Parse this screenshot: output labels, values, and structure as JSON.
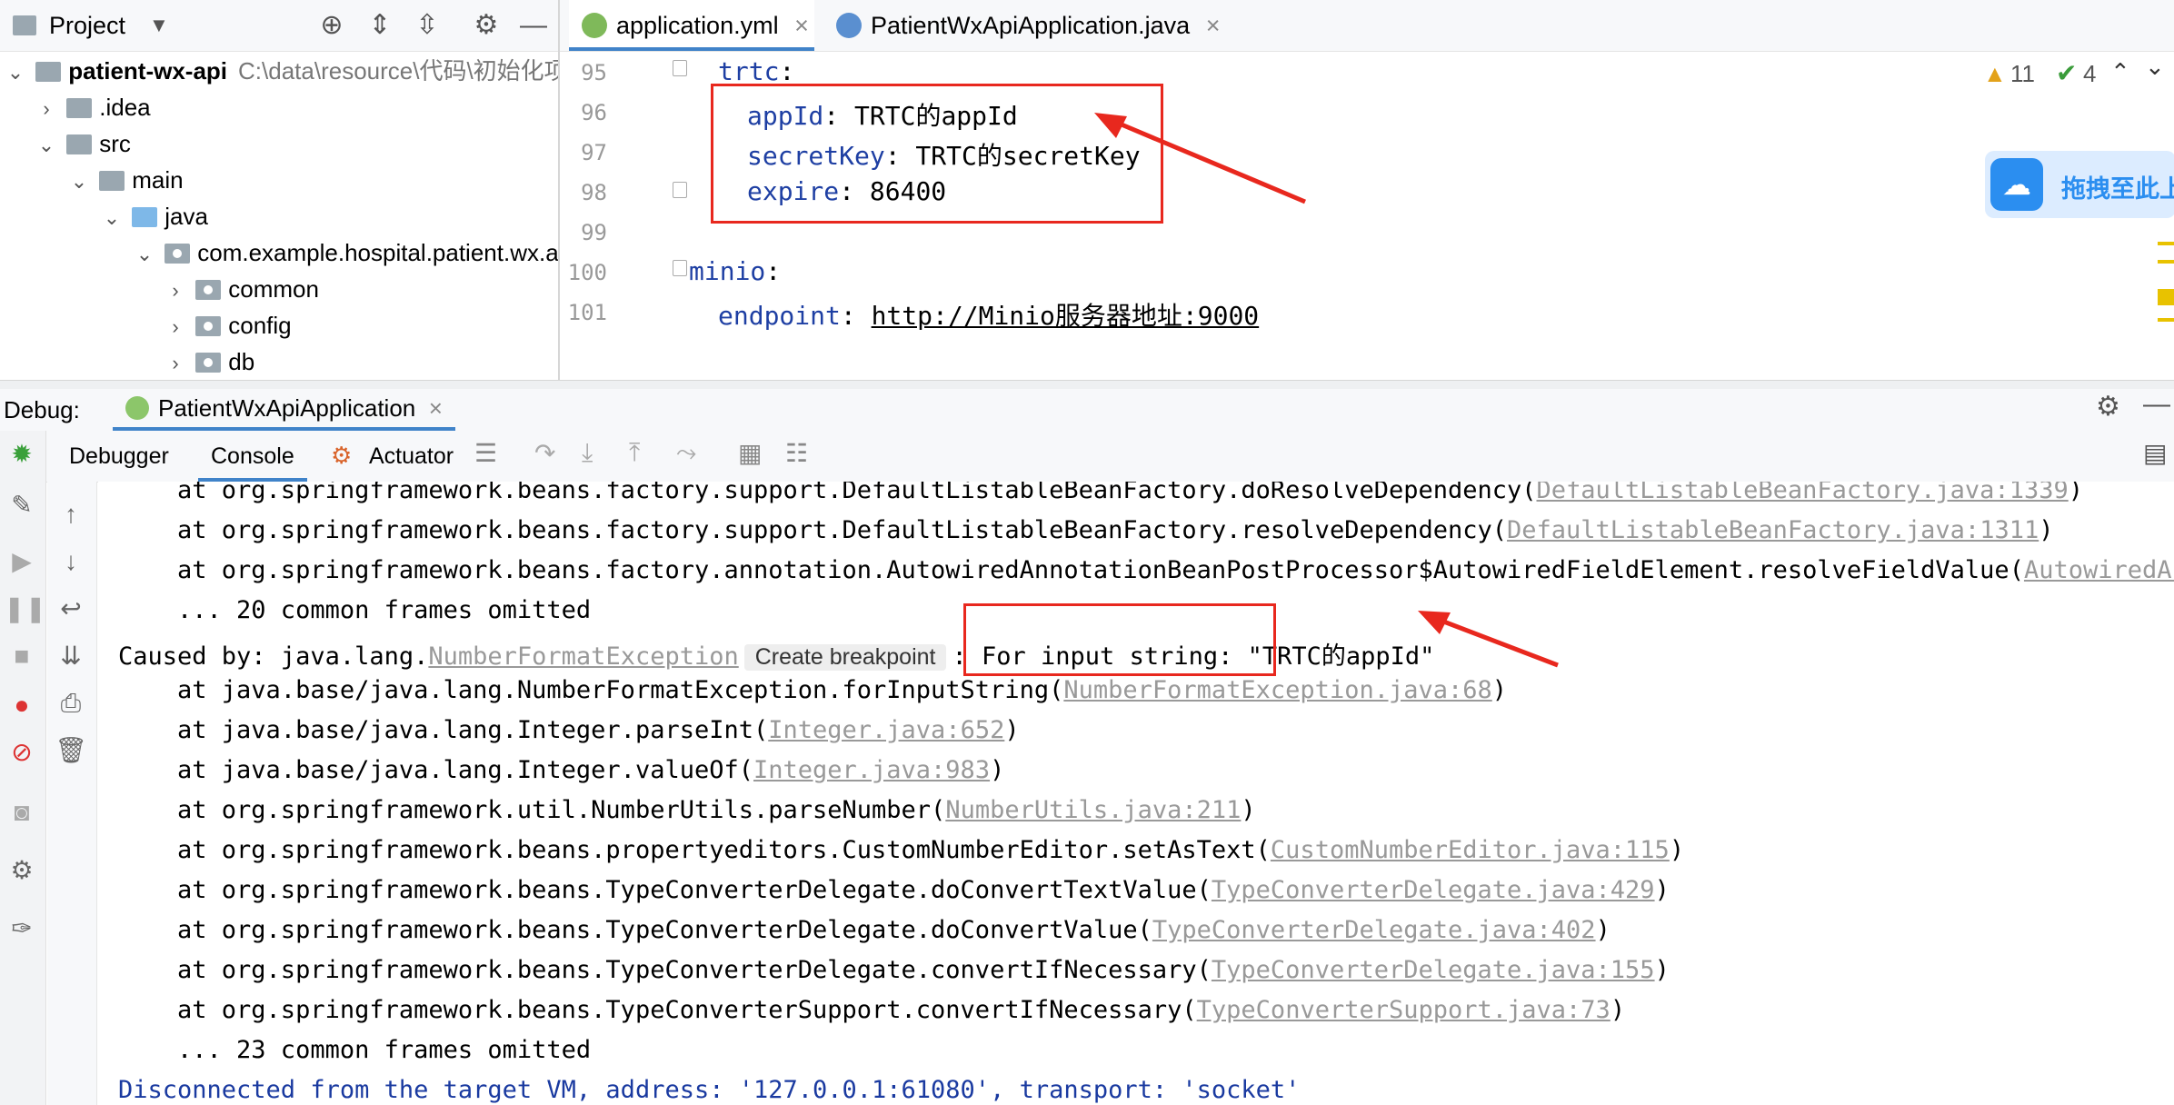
{
  "project": {
    "title": "Project",
    "root": "patient-wx-api",
    "root_path": "C:\\data\\resource\\代码\\初始化项",
    "items": [
      {
        "label": ".idea"
      },
      {
        "label": "src"
      },
      {
        "label": "main"
      },
      {
        "label": "java"
      },
      {
        "label": "com.example.hospital.patient.wx.a"
      },
      {
        "label": "common"
      },
      {
        "label": "config"
      },
      {
        "label": "db"
      }
    ]
  },
  "editor": {
    "tabs": [
      {
        "label": "application.yml"
      },
      {
        "label": "PatientWxApiApplication.java"
      }
    ],
    "lines": [
      {
        "num": "95",
        "key": "trtc",
        "rest": ":"
      },
      {
        "num": "96",
        "key": "appId",
        "rest": ": TRTC的appId"
      },
      {
        "num": "97",
        "key": "secretKey",
        "rest": ": TRTC的secretKey"
      },
      {
        "num": "98",
        "key": "expire",
        "rest": ": 86400"
      },
      {
        "num": "99",
        "key": "",
        "rest": ""
      },
      {
        "num": "100",
        "key": "minio",
        "rest": ":"
      },
      {
        "num": "101",
        "key": "endpoint",
        "rest": ": ",
        "url": "http://Minio服务器地址:9000"
      }
    ],
    "warnings": "11",
    "checks": "4"
  },
  "baidu_popup": {
    "label": "拖拽至此上"
  },
  "debug": {
    "label": "Debug:",
    "config": "PatientWxApiApplication",
    "tabs": [
      {
        "label": "Debugger"
      },
      {
        "label": "Console"
      },
      {
        "label": "Actuator"
      }
    ]
  },
  "console": {
    "lines": [
      {
        "text": "    at org.springframework.beans.factory.support.DefaultListableBeanFactory.doResolveDependency(",
        "link": "DefaultListableBeanFactory.java:1339",
        "tail": ")"
      },
      {
        "text": "    at org.springframework.beans.factory.support.DefaultListableBeanFactory.resolveDependency(",
        "link": "DefaultListableBeanFactory.java:1311",
        "tail": ")"
      },
      {
        "text": "    at org.springframework.beans.factory.annotation.AutowiredAnnotationBeanPostProcessor$AutowiredFieldElement.resolveFieldValue(",
        "link": "AutowiredAnno",
        "tail": ""
      },
      {
        "text": "    ... 20 common frames omitted",
        "link": "",
        "tail": ""
      },
      {
        "text": "    at java.base/java.lang.NumberFormatException.forInputString(",
        "link": "NumberFormatException.java:68",
        "tail": ")"
      },
      {
        "text": "    at java.base/java.lang.Integer.parseInt(",
        "link": "Integer.java:652",
        "tail": ")"
      },
      {
        "text": "    at java.base/java.lang.Integer.valueOf(",
        "link": "Integer.java:983",
        "tail": ")"
      },
      {
        "text": "    at org.springframework.util.NumberUtils.parseNumber(",
        "link": "NumberUtils.java:211",
        "tail": ")"
      },
      {
        "text": "    at org.springframework.beans.propertyeditors.CustomNumberEditor.setAsText(",
        "link": "CustomNumberEditor.java:115",
        "tail": ")"
      },
      {
        "text": "    at org.springframework.beans.TypeConverterDelegate.doConvertTextValue(",
        "link": "TypeConverterDelegate.java:429",
        "tail": ")"
      },
      {
        "text": "    at org.springframework.beans.TypeConverterDelegate.doConvertValue(",
        "link": "TypeConverterDelegate.java:402",
        "tail": ")"
      },
      {
        "text": "    at org.springframework.beans.TypeConverterDelegate.convertIfNecessary(",
        "link": "TypeConverterDelegate.java:155",
        "tail": ")"
      },
      {
        "text": "    at org.springframework.beans.TypeConverterSupport.convertIfNecessary(",
        "link": "TypeConverterSupport.java:73",
        "tail": ")"
      },
      {
        "text": "    ... 23 common frames omitted",
        "link": "",
        "tail": ""
      }
    ],
    "caused_prefix": "Caused by: java.lang.",
    "caused_link": "NumberFormatException",
    "create_breakpoint": "Create breakpoint",
    "caused_sep": ":",
    "caused_msg": "For input string: \"TRTC的appId\"",
    "disconnected": "Disconnected from the target VM, address: '127.0.0.1:61080', transport: 'socket'"
  }
}
